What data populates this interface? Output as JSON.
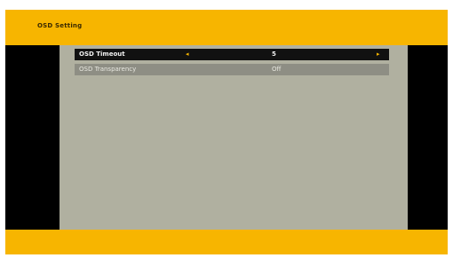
{
  "header": {
    "title": "OSD Setting"
  },
  "menu": {
    "items": [
      {
        "label": "OSD Timeout",
        "value": "5"
      },
      {
        "label": "OSD Transparency",
        "value": "Off"
      }
    ],
    "selected_index": 0
  },
  "icons": {
    "left_arrow": "chevron-left-icon",
    "right_arrow": "chevron-right-icon"
  },
  "colors": {
    "accent_bar": "#f7b500",
    "panel_background": "#b0b0a0",
    "selected_row": "#111111",
    "unselected_row": "#8e8e84"
  }
}
